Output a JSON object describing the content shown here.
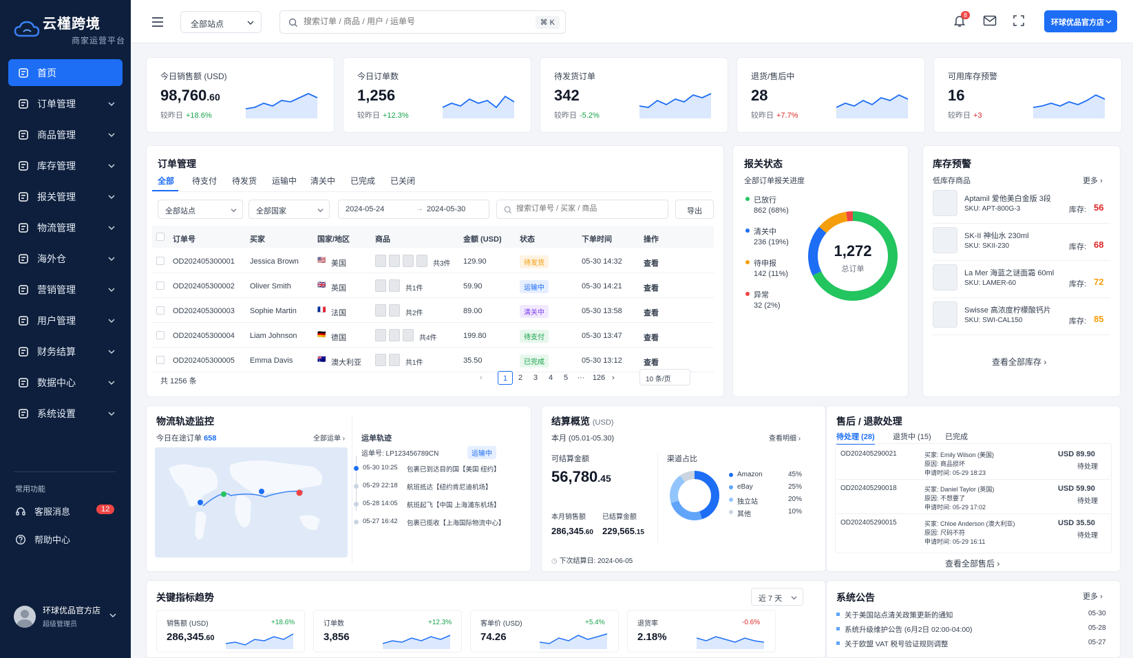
{
  "brand": {
    "name": "云槿跨境",
    "sub": "商家运营平台"
  },
  "nav": [
    {
      "label": "首页",
      "active": true
    },
    {
      "label": "订单管理"
    },
    {
      "label": "商品管理"
    },
    {
      "label": "库存管理"
    },
    {
      "label": "报关管理"
    },
    {
      "label": "物流管理"
    },
    {
      "label": "海外仓"
    },
    {
      "label": "营销管理"
    },
    {
      "label": "用户管理"
    },
    {
      "label": "财务结算"
    },
    {
      "label": "数据中心"
    },
    {
      "label": "系统设置"
    }
  ],
  "common": {
    "title": "常用功能",
    "items": [
      {
        "label": "客服消息",
        "badge": "12"
      },
      {
        "label": "帮助中心"
      }
    ]
  },
  "user": {
    "name": "环球优品官方店",
    "role": "超级管理员"
  },
  "topbar": {
    "site_select": "全部站点",
    "search_placeholder": "搜索订单 / 商品 / 用户 / 运单号",
    "shortcut": "⌘ K",
    "notif_count": "8",
    "shop_button": "环球优品官方店"
  },
  "stats": [
    {
      "label": "今日销售额 (USD)",
      "value": "98,760",
      "decimal": ".60",
      "cmp_label": "较昨日",
      "cmp": "+18.6%",
      "cmp_color": "#16a34a"
    },
    {
      "label": "今日订单数",
      "value": "1,256",
      "decimal": "",
      "cmp_label": "较昨日",
      "cmp": "+12.3%",
      "cmp_color": "#16a34a"
    },
    {
      "label": "待发货订单",
      "value": "342",
      "decimal": "",
      "cmp_label": "较昨日",
      "cmp": "-5.2%",
      "cmp_color": "#16a34a"
    },
    {
      "label": "退货/售后中",
      "value": "28",
      "decimal": "",
      "cmp_label": "较昨日",
      "cmp": "+7.7%",
      "cmp_color": "#dc2626"
    },
    {
      "label": "可用库存预警",
      "value": "16",
      "decimal": "",
      "cmp_label": "较昨日",
      "cmp": "+3",
      "cmp_color": "#dc2626"
    }
  ],
  "orders": {
    "title": "订单管理",
    "tabs": [
      "全部",
      "待支付",
      "待发货",
      "运输中",
      "清关中",
      "已完成",
      "已关闭"
    ],
    "filters": {
      "site": "全部站点",
      "country": "全部国家",
      "date_from": "2024-05-24",
      "date_to": "2024-05-30",
      "search_placeholder": "搜索订单号 / 买家 / 商品",
      "export": "导出"
    },
    "columns": [
      "订单号",
      "买家",
      "国家/地区",
      "商品",
      "金额 (USD)",
      "状态",
      "下单时间",
      "操作"
    ],
    "rows": [
      {
        "id": "OD202405300001",
        "buyer": "Jessica Brown",
        "flag": "🇺🇸",
        "country": "美国",
        "items": "共3件",
        "amount": "129.90",
        "status": "待发货",
        "status_color": "#f59e0b",
        "status_bg": "#fef3e2",
        "time": "05-30 14:32",
        "action": "查看"
      },
      {
        "id": "OD202405300002",
        "buyer": "Oliver Smith",
        "flag": "🇬🇧",
        "country": "英国",
        "items": "共1件",
        "amount": "59.90",
        "status": "运输中",
        "status_color": "#1d6ef5",
        "status_bg": "#e6efff",
        "time": "05-30 14:21",
        "action": "查看"
      },
      {
        "id": "OD202405300003",
        "buyer": "Sophie Martin",
        "flag": "🇫🇷",
        "country": "法国",
        "items": "共2件",
        "amount": "89.00",
        "status": "清关中",
        "status_color": "#7c3aed",
        "status_bg": "#f1eafe",
        "time": "05-30 13:58",
        "action": "查看"
      },
      {
        "id": "OD202405300004",
        "buyer": "Liam Johnson",
        "flag": "🇩🇪",
        "country": "德国",
        "items": "共4件",
        "amount": "199.80",
        "status": "待支付",
        "status_color": "#16a34a",
        "status_bg": "#e7f7ec",
        "time": "05-30 13:47",
        "action": "查看"
      },
      {
        "id": "OD202405300005",
        "buyer": "Emma Davis",
        "flag": "🇦🇺",
        "country": "澳大利亚",
        "items": "共1件",
        "amount": "35.50",
        "status": "已完成",
        "status_color": "#16a34a",
        "status_bg": "#e7f7ec",
        "time": "05-30 13:12",
        "action": "查看"
      }
    ],
    "total": "共 1256 条",
    "pages": [
      "1",
      "2",
      "3",
      "4",
      "5",
      "···",
      "126"
    ],
    "page_size": "10 条/页"
  },
  "customs": {
    "title": "报关状态",
    "subtitle": "全部订单报关进度",
    "total": "1,272",
    "total_label": "总订单",
    "items": [
      {
        "label": "已放行",
        "value": "862 (68%)",
        "color": "#22c55e",
        "count": 862
      },
      {
        "label": "清关中",
        "value": "236 (19%)",
        "color": "#1d6ef5",
        "count": 236
      },
      {
        "label": "待申报",
        "value": "142 (11%)",
        "color": "#f59e0b",
        "count": 142
      },
      {
        "label": "异常",
        "value": "32 (2%)",
        "color": "#ef4444",
        "count": 32
      }
    ]
  },
  "inventory": {
    "title": "库存预警",
    "subtitle": "低库存商品",
    "more": "更多",
    "view_all": "查看全部库存",
    "items": [
      {
        "name": "Aptamil 爱他美白金版 3段",
        "sku": "SKU: APT-800G-3",
        "stock_label": "库存:",
        "stock": "56",
        "color": "#dc2626"
      },
      {
        "name": "SK-II 神仙水 230ml",
        "sku": "SKU: SKII-230",
        "stock_label": "库存:",
        "stock": "68",
        "color": "#dc2626"
      },
      {
        "name": "La Mer 海蓝之谜面霜 60ml",
        "sku": "SKU: LAMER-60",
        "stock_label": "库存:",
        "stock": "72",
        "color": "#f59e0b"
      },
      {
        "name": "Swisse 高浓度柠檬酸钙片",
        "sku": "SKU: SWI-CAL150",
        "stock_label": "库存:",
        "stock": "85",
        "color": "#f59e0b"
      }
    ]
  },
  "logistics": {
    "title": "物流轨迹监控",
    "today_label": "今日在途订单",
    "today_count": "658",
    "all_link": "全部运单",
    "track_title": "运单轨迹",
    "tracking_no": "运单号: LP123456789CN",
    "status": "运输中",
    "events": [
      {
        "time": "05-30 10:25",
        "text": "包裹已到达目的国【美国 纽约】"
      },
      {
        "time": "05-29 22:18",
        "text": "航班抵达【纽约肯尼迪机场】"
      },
      {
        "time": "05-28 14:05",
        "text": "航班起飞【中国 上海浦东机场】"
      },
      {
        "time": "05-27 16:42",
        "text": "包裹已揽收【上海国际物流中心】"
      }
    ]
  },
  "settlement": {
    "title": "结算概览",
    "unit": "(USD)",
    "period": "本月 (05.01-05.30)",
    "detail": "查看明细",
    "avail_label": "可结算金额",
    "avail": "56,780",
    "avail_dec": ".45",
    "sales_label": "本月销售额",
    "sales": "286,345",
    "sales_dec": ".60",
    "settled_label": "已结算金额",
    "settled": "229,565",
    "settled_dec": ".15",
    "next": "下次结算日: 2024-06-05",
    "channel_title": "渠道占比",
    "channels": [
      {
        "name": "Amazon",
        "pct": "45%",
        "value": 45,
        "color": "#1d6ef5"
      },
      {
        "name": "eBay",
        "pct": "25%",
        "value": 25,
        "color": "#60a5fa"
      },
      {
        "name": "独立站",
        "pct": "20%",
        "value": 20,
        "color": "#93c5fd"
      },
      {
        "name": "其他",
        "pct": "10%",
        "value": 10,
        "color": "#cbd5e1"
      }
    ]
  },
  "aftersale": {
    "title": "售后 / 退款处理",
    "tabs": [
      "待处理 (28)",
      "退货中 (15)",
      "已完成"
    ],
    "view_all": "查看全部售后",
    "items": [
      {
        "id": "OD202405290021",
        "buyer": "买家: Emily Wilson (美国)",
        "reason": "原因: 商品损坏",
        "time": "申请时间: 05-29 18:23",
        "amount": "USD 89.90",
        "status": "待处理"
      },
      {
        "id": "OD202405290018",
        "buyer": "买家: Daniel Taylor (英国)",
        "reason": "原因: 不想要了",
        "time": "申请时间: 05-29 17:02",
        "amount": "USD 59.90",
        "status": "待处理"
      },
      {
        "id": "OD202405290015",
        "buyer": "买家: Chloe Anderson (澳大利亚)",
        "reason": "原因: 尺码不符",
        "time": "申请时间: 05-29 16:11",
        "amount": "USD 35.50",
        "status": "待处理"
      }
    ]
  },
  "kpi": {
    "title": "关键指标趋势",
    "range": "近 7 天",
    "items": [
      {
        "label": "销售额 (USD)",
        "value": "286,345",
        "dec": ".60",
        "change": "+18.6%",
        "color": "#16a34a"
      },
      {
        "label": "订单数",
        "value": "3,856",
        "dec": "",
        "change": "+12.3%",
        "color": "#16a34a"
      },
      {
        "label": "客单价 (USD)",
        "value": "74.26",
        "dec": "",
        "change": "+5.4%",
        "color": "#16a34a"
      },
      {
        "label": "退货率",
        "value": "2.18%",
        "dec": "",
        "change": "-0.6%",
        "color": "#dc2626"
      }
    ]
  },
  "notices": {
    "title": "系统公告",
    "more": "更多",
    "items": [
      {
        "text": "关于美国站点清关政策更新的通知",
        "date": "05-30"
      },
      {
        "text": "系统升级维护公告 (6月2日 02:00-04:00)",
        "date": "05-28"
      },
      {
        "text": "关于欧盟 VAT 税号验证规则调整",
        "date": "05-27"
      }
    ]
  }
}
